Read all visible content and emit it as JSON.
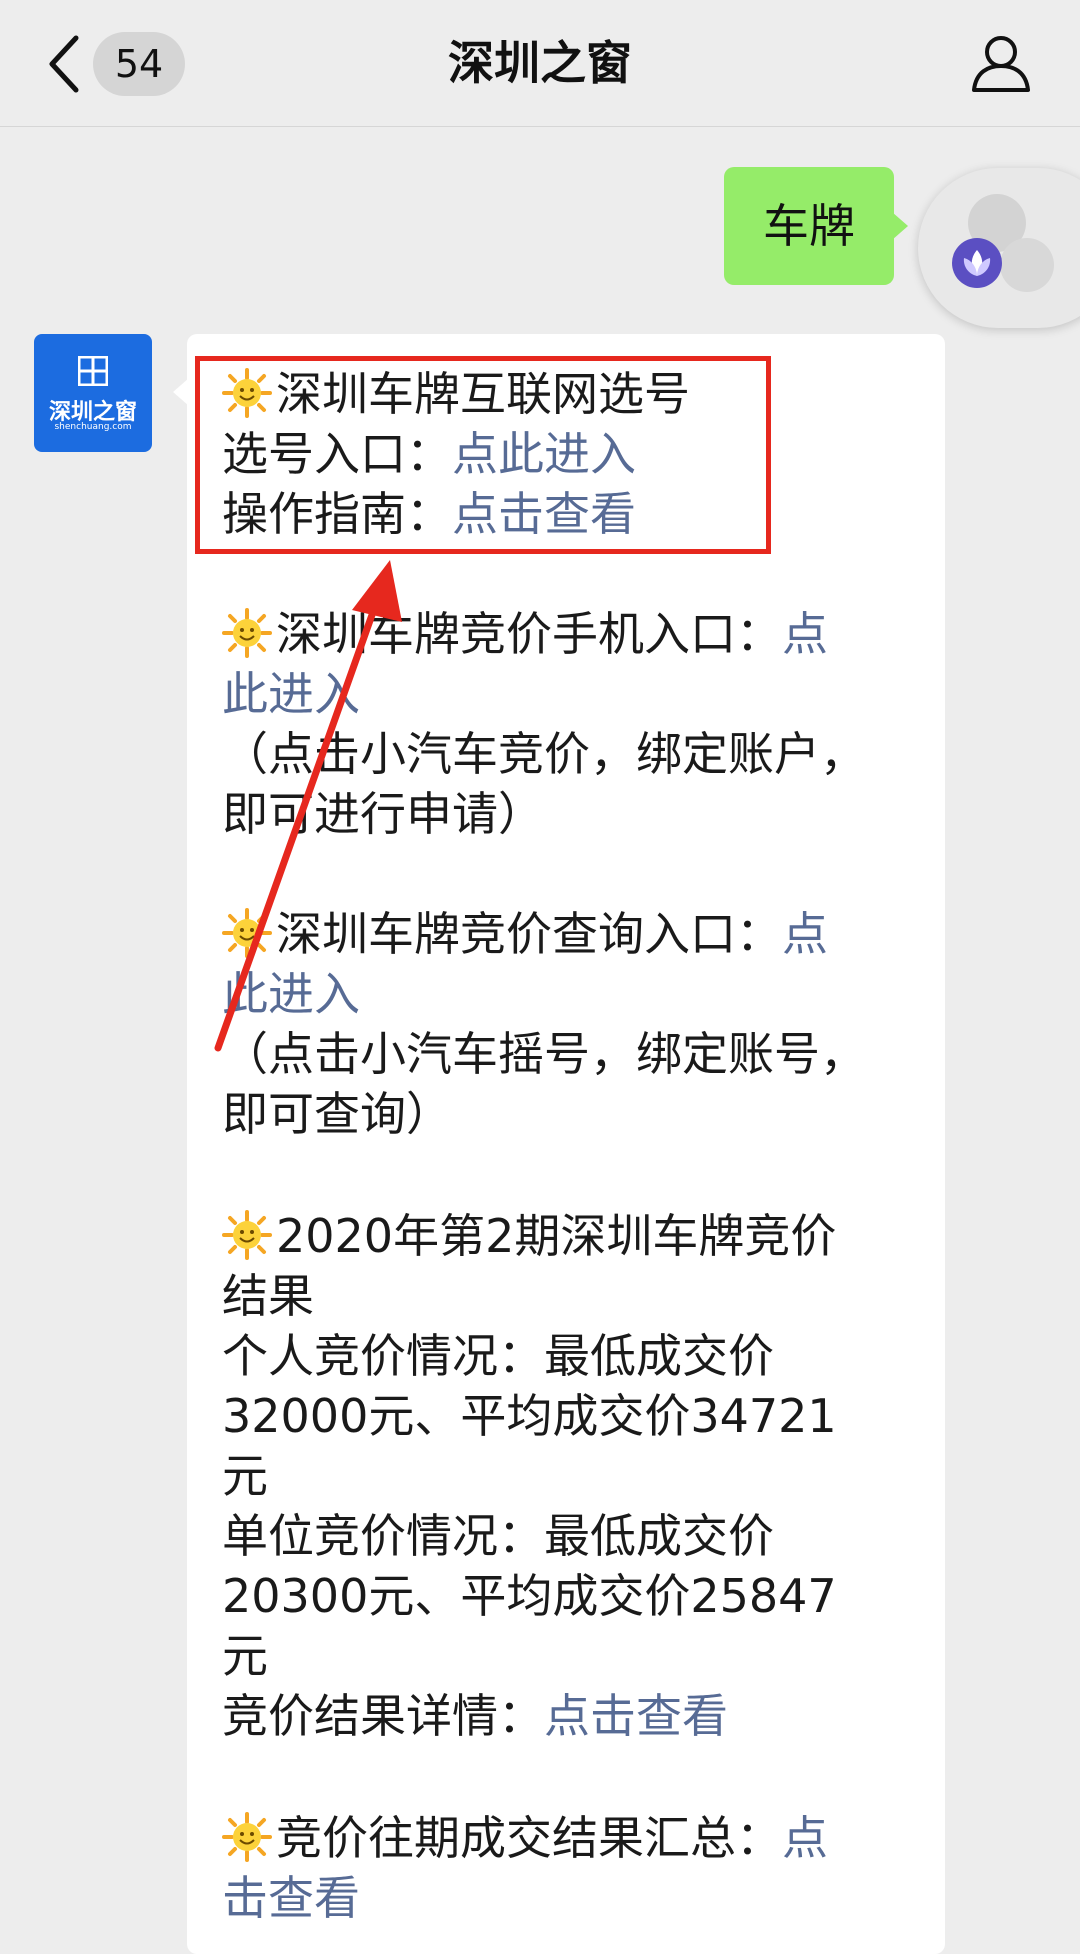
{
  "header": {
    "unread_count": "54",
    "title": "深圳之窗"
  },
  "sent": {
    "text": "车牌"
  },
  "avatar": {
    "label": "深圳之窗",
    "sub": "shenchuang.com"
  },
  "message": {
    "block1": {
      "title": "深圳车牌互联网选号",
      "entry_label": "选号入口：",
      "entry_link": "点此进入",
      "guide_label": "操作指南：",
      "guide_link": "点击查看"
    },
    "block2": {
      "line1_text": "深圳车牌竞价手机入口：",
      "line1_link": "点",
      "line2_link": "此进入",
      "line3": "（点击小汽车竞价，绑定账户，",
      "line4": "即可进行申请）"
    },
    "block3": {
      "line1_text": "深圳车牌竞价查询入口：",
      "line1_link": "点",
      "line2_link": "此进入",
      "line3": "（点击小汽车摇号，绑定账号，",
      "line4": "即可查询）"
    },
    "block4": {
      "line1": "2020年第2期深圳车牌竞价",
      "line2": "结果",
      "line3": "个人竞价情况：最低成交价",
      "line4": "32000元、平均成交价34721",
      "line5": "元",
      "line6": "单位竞价情况：最低成交价",
      "line7": "20300元、平均成交价25847",
      "line8": "元",
      "line9_text": "竞价结果详情：",
      "line9_link": "点击查看"
    },
    "block5": {
      "line1_text": "竞价往期成交结果汇总：",
      "line1_link": "点",
      "line2_link": "击查看"
    }
  },
  "colors": {
    "link": "#576b95",
    "sent_bubble": "#95ec69",
    "highlight_box": "#e6281e",
    "avatar_bg": "#1c6ce0"
  }
}
